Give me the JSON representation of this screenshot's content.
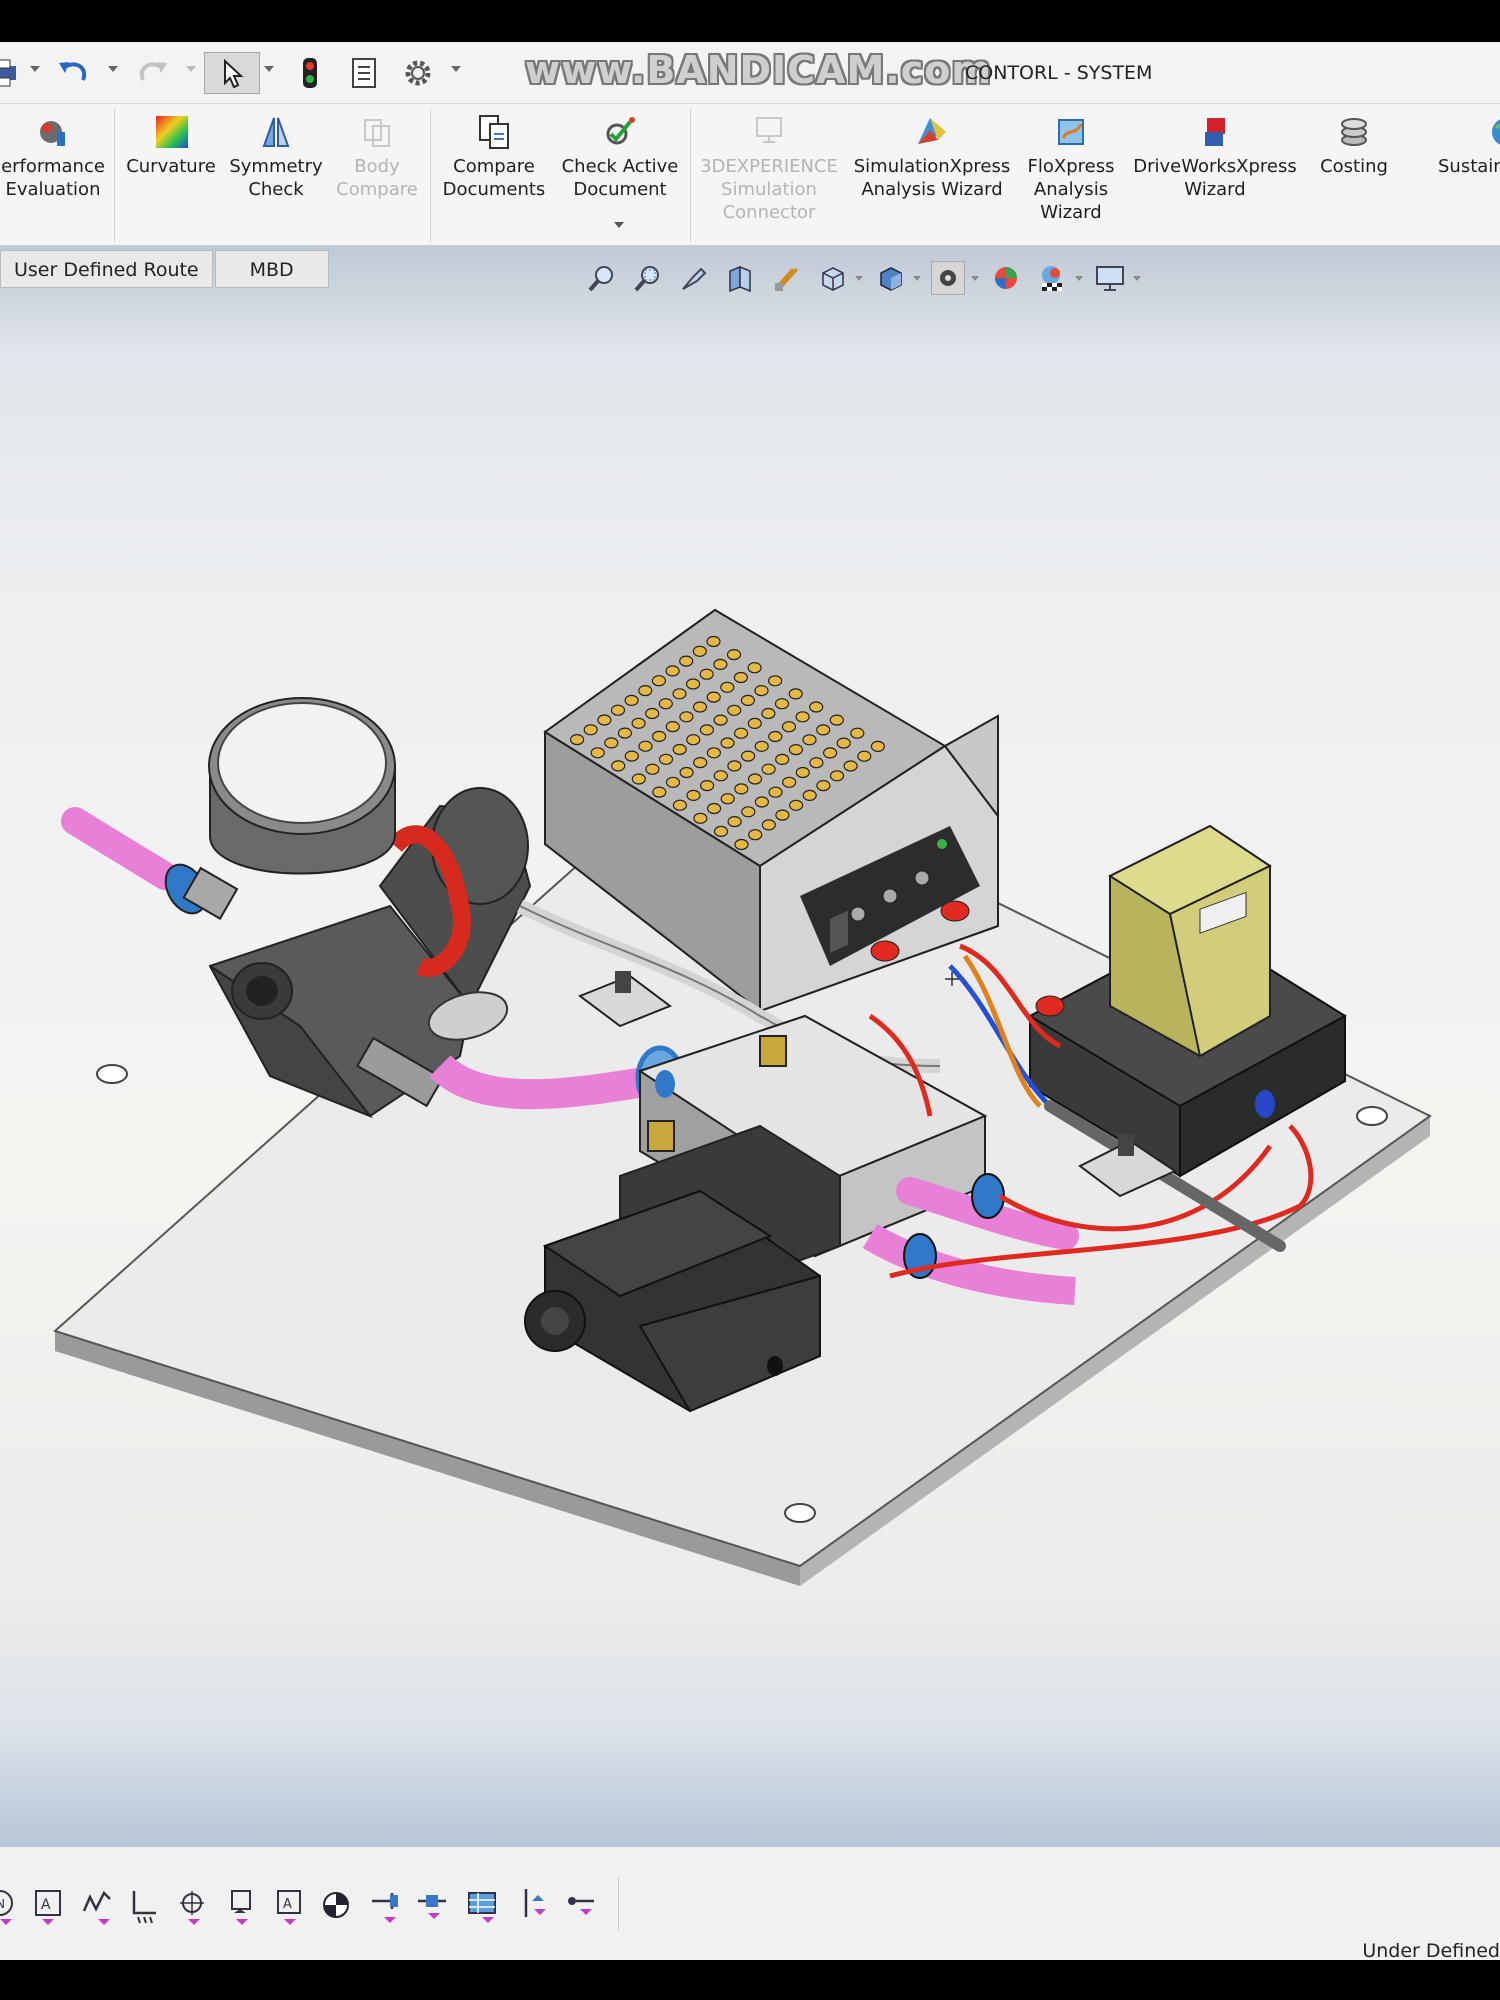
{
  "app": {
    "document_title": "CONTORL - SYSTEM",
    "watermark": "www.BANDICAM.com"
  },
  "quick_access": [
    {
      "name": "print",
      "icon": "print-icon"
    },
    {
      "name": "undo",
      "icon": "undo-icon"
    },
    {
      "name": "redo",
      "icon": "redo-icon"
    },
    {
      "name": "select",
      "icon": "pointer-icon"
    },
    {
      "name": "rebuild",
      "icon": "traffic-light-icon"
    },
    {
      "name": "file-properties",
      "icon": "file-properties-icon"
    },
    {
      "name": "options",
      "icon": "gear-icon"
    }
  ],
  "ribbon": {
    "buttons": [
      {
        "label": "erformance\nEvaluation",
        "icon": "performance-evaluation-icon",
        "enabled": true
      },
      {
        "label": "Curvature",
        "icon": "curvature-icon",
        "enabled": true
      },
      {
        "label": "Symmetry\nCheck",
        "icon": "symmetry-check-icon",
        "enabled": true
      },
      {
        "label": "Body\nCompare",
        "icon": "body-compare-icon",
        "enabled": false
      },
      {
        "label": "Compare\nDocuments",
        "icon": "compare-documents-icon",
        "enabled": true
      },
      {
        "label": "Check Active\nDocument",
        "icon": "check-active-document-icon",
        "enabled": true
      },
      {
        "label": "3DEXPERIENCE\nSimulation\nConnector",
        "icon": "simulation-connector-icon",
        "enabled": false
      },
      {
        "label": "SimulationXpress\nAnalysis Wizard",
        "icon": "simulationxpress-icon",
        "enabled": true
      },
      {
        "label": "FloXpress\nAnalysis\nWizard",
        "icon": "floxpress-icon",
        "enabled": true
      },
      {
        "label": "DriveWorksXpress\nWizard",
        "icon": "driveworksxpress-icon",
        "enabled": true
      },
      {
        "label": "Costing",
        "icon": "costing-icon",
        "enabled": true
      },
      {
        "label": "Sustain",
        "icon": "sustainability-icon",
        "enabled": true
      }
    ]
  },
  "tabs": [
    {
      "label": "User Defined Route"
    },
    {
      "label": "MBD"
    }
  ],
  "heads_up": [
    {
      "icon": "zoom-to-fit-icon"
    },
    {
      "icon": "zoom-to-area-icon"
    },
    {
      "icon": "previous-view-icon"
    },
    {
      "icon": "section-view-icon"
    },
    {
      "icon": "dynamic-annotation-icon"
    },
    {
      "icon": "view-orientation-icon"
    },
    {
      "icon": "display-style-icon"
    },
    {
      "icon": "hide-show-icon"
    },
    {
      "icon": "edit-appearance-icon"
    },
    {
      "icon": "apply-scene-icon"
    },
    {
      "icon": "view-settings-icon"
    }
  ],
  "viewport": {
    "model": "pneumatic control system assembly"
  },
  "command_manager_bottom": [
    {
      "icon": "note-icon"
    },
    {
      "icon": "balloon-icon"
    },
    {
      "icon": "surface-finish-icon"
    },
    {
      "icon": "weld-symbol-icon"
    },
    {
      "icon": "geometric-tolerance-icon"
    },
    {
      "icon": "datum-feature-icon"
    },
    {
      "icon": "datum-target-icon"
    },
    {
      "icon": "center-mark-icon"
    },
    {
      "icon": "hole-callout-icon"
    },
    {
      "icon": "centerline-icon"
    },
    {
      "icon": "table-icon"
    },
    {
      "icon": "revision-symbol-icon"
    },
    {
      "icon": "magnetic-line-icon"
    }
  ],
  "status": {
    "text": "Under Defined"
  },
  "colors": {
    "tube_pink": "#e880d8",
    "fitting_blue": "#2f79c8",
    "wire_red": "#e02a20",
    "relay_yellow": "#d8d47c",
    "psu_yellow": "#e8b840"
  }
}
